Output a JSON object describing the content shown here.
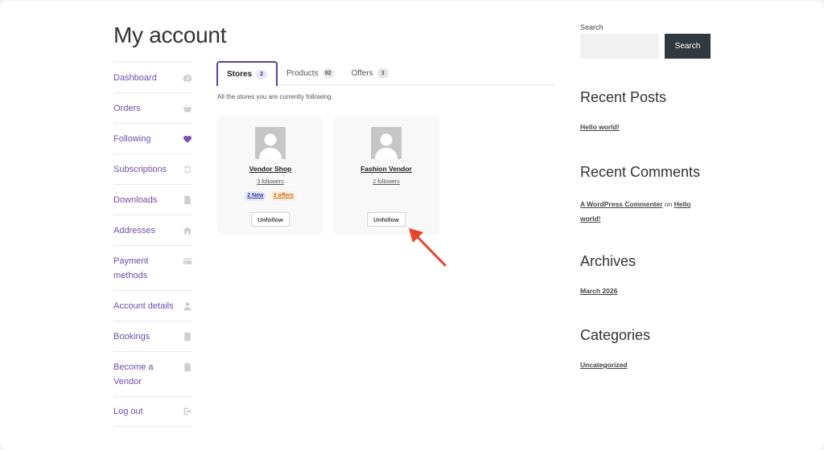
{
  "page": {
    "title": "My account"
  },
  "nav": {
    "items": [
      {
        "label": "Dashboard",
        "icon": "dashboard-icon"
      },
      {
        "label": "Orders",
        "icon": "basket-icon"
      },
      {
        "label": "Following",
        "icon": "heart-icon"
      },
      {
        "label": "Subscriptions",
        "icon": "refresh-icon"
      },
      {
        "label": "Downloads",
        "icon": "file-icon"
      },
      {
        "label": "Addresses",
        "icon": "home-icon"
      },
      {
        "label": "Payment methods",
        "icon": "credit-card-icon"
      },
      {
        "label": "Account details",
        "icon": "user-icon"
      },
      {
        "label": "Bookings",
        "icon": "file-icon"
      },
      {
        "label": "Become a Vendor",
        "icon": "file-icon"
      },
      {
        "label": "Log out",
        "icon": "logout-icon"
      }
    ],
    "active": "Following"
  },
  "tabs": [
    {
      "label": "Stores",
      "count": "2"
    },
    {
      "label": "Products",
      "count": "92"
    },
    {
      "label": "Offers",
      "count": "3"
    }
  ],
  "tab_description": "All the stores you are currently following.",
  "stores": [
    {
      "name": "Vendor Shop",
      "followers": "3 followers",
      "new_label": "2 New",
      "offers_label": "3 offers",
      "unfollow_label": "Unfollow"
    },
    {
      "name": "Fashion Vendor",
      "followers": "2 followers",
      "unfollow_label": "Unfollow"
    }
  ],
  "sidebar": {
    "search": {
      "label": "Search",
      "placeholder": "",
      "button_label": "Search"
    },
    "recent_posts": {
      "title": "Recent Posts",
      "items": [
        "Hello world!"
      ]
    },
    "recent_comments": {
      "title": "Recent Comments",
      "author": "A WordPress Commenter",
      "connector": "on",
      "post": "Hello world!"
    },
    "archives": {
      "title": "Archives",
      "items": [
        "March 2026"
      ]
    },
    "categories": {
      "title": "Categories",
      "items": [
        "Uncategorized"
      ]
    }
  },
  "colors": {
    "accent": "#6b4faa",
    "arrow": "#e8432d",
    "button_dark": "#333a3f"
  }
}
